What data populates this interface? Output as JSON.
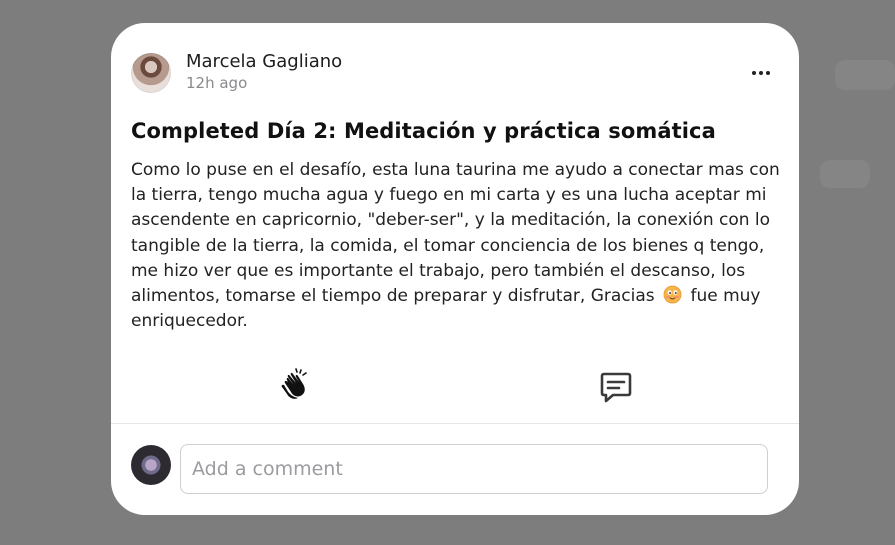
{
  "post": {
    "author": "Marcela Gagliano",
    "time": "12h ago",
    "title": "Completed Día 2: Meditación y práctica somática",
    "body_before_emoji": "Como lo puse en el desafío, esta luna taurina me ayudo a conectar mas con la tierra, tengo mucha agua y fuego en mi carta y es una lucha aceptar mi ascendente en capricornio, \"deber-ser\", y la meditación, la conexión con lo tangible de la tierra, la comida, el tomar conciencia de los bienes q tengo, me hizo ver que es importante el trabajo, pero también el descanso, los alimentos, tomarse el tiempo de preparar y disfrutar, Gracias",
    "body_after_emoji": "fue muy enriquecedor.",
    "emoji_icon": "smiling-face-emoji",
    "more_icon": "more-horizontal-icon"
  },
  "actions": {
    "clap_icon": "clapping-hands-icon",
    "comment_icon": "comment-bubble-icon"
  },
  "comment": {
    "placeholder": "Add a comment"
  },
  "colors": {
    "backdrop": "#7d7d7d",
    "card": "#ffffff",
    "text": "#222222",
    "muted": "#8a8a8e"
  }
}
